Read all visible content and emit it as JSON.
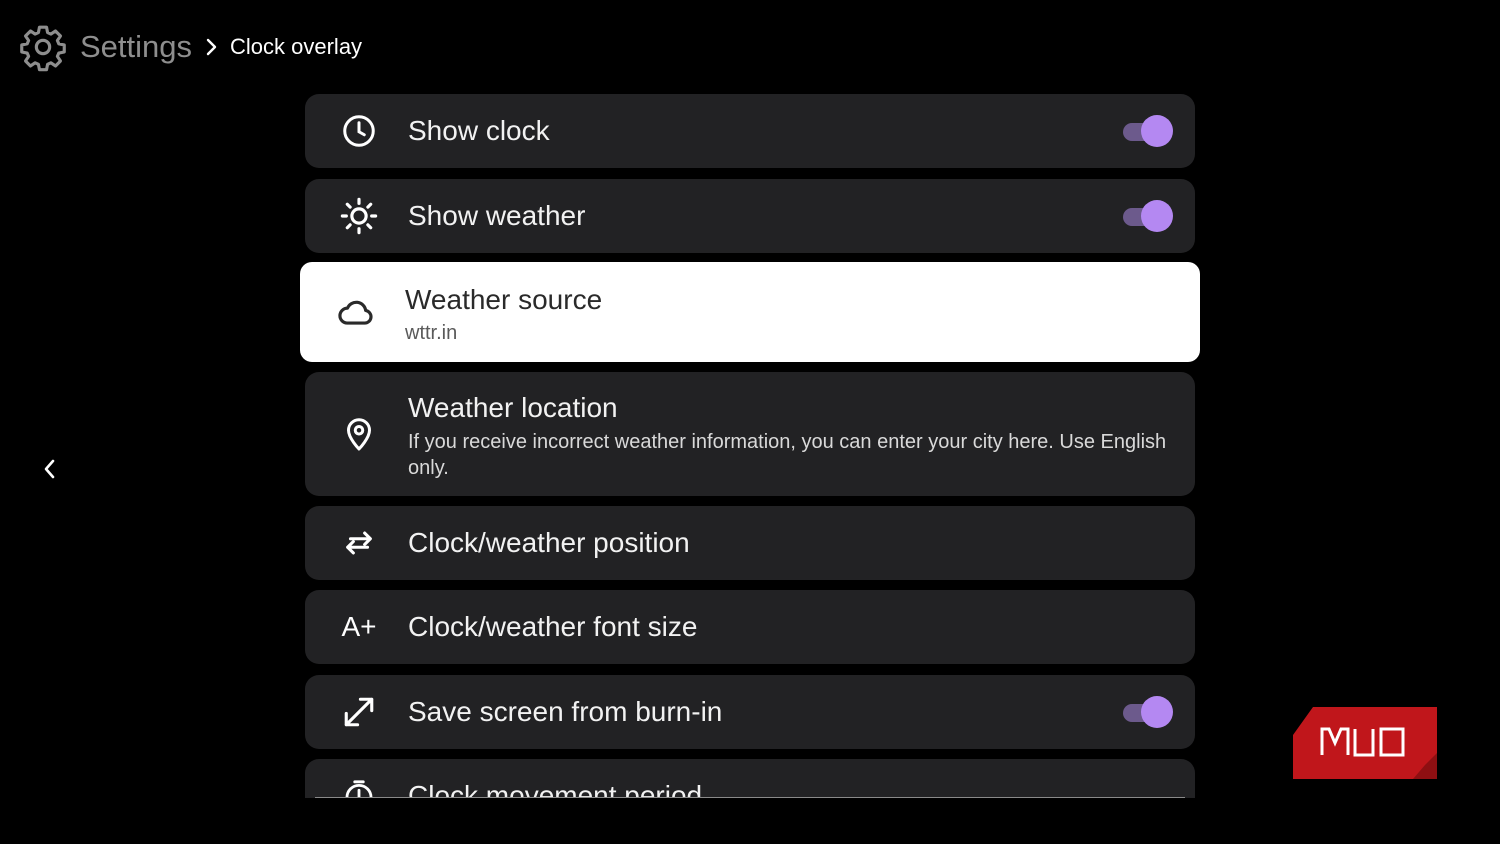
{
  "header": {
    "icon": "gear-icon",
    "breadcrumb_root": "Settings",
    "separator_icon": "chevron-right-icon",
    "breadcrumb_current": "Clock overlay"
  },
  "nav": {
    "back_icon": "chevron-left-icon"
  },
  "settings": [
    {
      "label": "Show clock",
      "icon": "clock-icon",
      "toggle": true
    },
    {
      "label": "Show weather",
      "icon": "sun-icon",
      "toggle": true
    },
    {
      "label": "Weather source",
      "sublabel": "wttr.in",
      "icon": "cloud-icon",
      "focused": true
    },
    {
      "label": "Weather location",
      "sublabel": "If you receive incorrect weather information, you can enter your city here. Use English only.",
      "icon": "location-pin-icon"
    },
    {
      "label": "Clock/weather position",
      "icon": "swap-arrows-icon"
    },
    {
      "label": "Clock/weather font size",
      "icon": "font-size-icon",
      "icon_text": "A+"
    },
    {
      "label": "Save screen from burn-in",
      "icon": "expand-arrows-icon",
      "toggle": true
    },
    {
      "label": "Clock movement period",
      "icon": "timer-icon"
    }
  ],
  "watermark": {
    "text": "MUO",
    "color": "#c0161b"
  },
  "colors": {
    "background": "#000000",
    "card": "#222224",
    "card_focused": "#ffffff",
    "toggle_thumb": "#b488f2",
    "toggle_track": "#6c5a8c"
  }
}
